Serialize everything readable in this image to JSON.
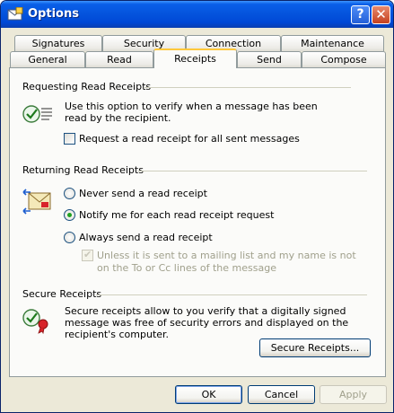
{
  "window": {
    "title": "Options"
  },
  "tabs_back": [
    "Signatures",
    "Security",
    "Connection",
    "Maintenance"
  ],
  "tabs_front": [
    "General",
    "Read",
    "Receipts",
    "Send",
    "Compose"
  ],
  "active_tab": "Receipts",
  "requesting": {
    "title": "Requesting Read Receipts",
    "description": "Use this option to verify when a message has been read by the recipient.",
    "checkbox_label": "Request a read receipt for all sent messages",
    "checked": false
  },
  "returning": {
    "title": "Returning Read Receipts",
    "options": [
      "Never send a read receipt",
      "Notify me for each read receipt request",
      "Always send a read receipt"
    ],
    "selected": "Notify me for each read receipt request",
    "sub_checkbox_label": "Unless it is sent to a mailing list and my name is not on the To or Cc lines of the message",
    "sub_checked": true,
    "sub_enabled": false
  },
  "secure": {
    "title": "Secure Receipts",
    "description": "Secure receipts allow to you verify that a digitally signed message was free of security errors and displayed on the recipient's computer.",
    "button": "Secure Receipts..."
  },
  "buttons": {
    "ok": "OK",
    "cancel": "Cancel",
    "apply": "Apply"
  },
  "titlebar_buttons": {
    "help": "?",
    "close": "✕"
  }
}
